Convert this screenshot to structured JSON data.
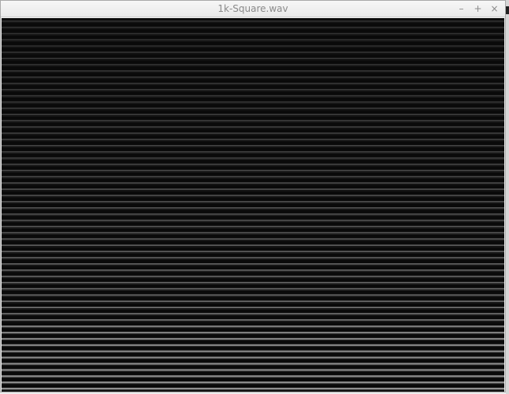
{
  "window": {
    "title": "1k-Square.wav"
  },
  "controls": {
    "minimize_glyph": "–",
    "maximize_glyph": "+",
    "close_glyph": "×"
  },
  "spectrogram": {
    "background": "#0a0a0a",
    "band_color": "#9a9a9a"
  }
}
